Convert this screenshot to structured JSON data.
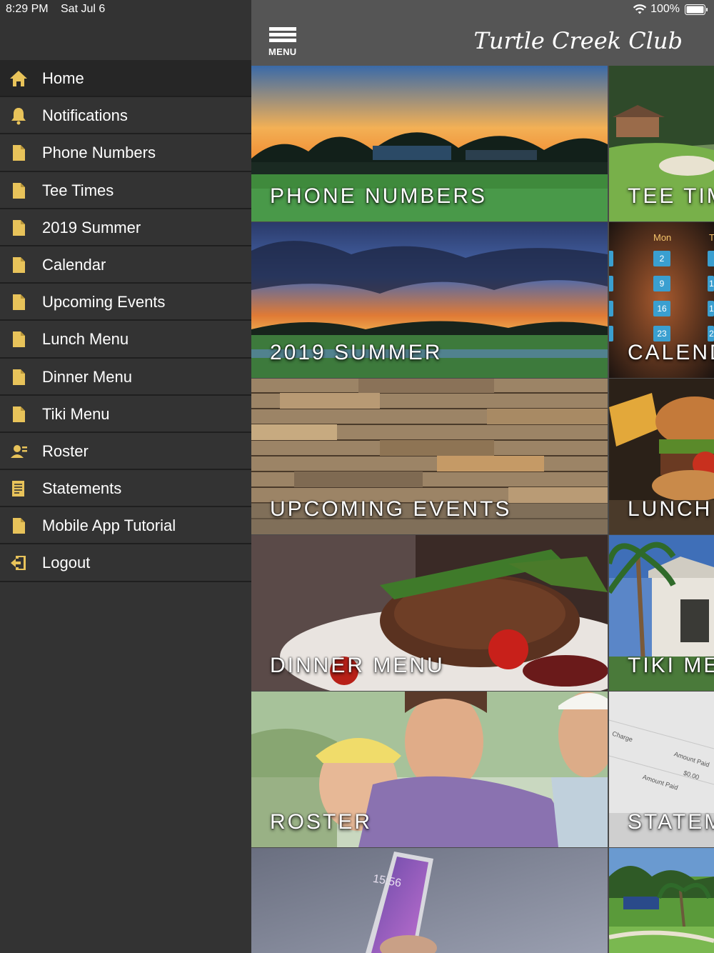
{
  "status_bar": {
    "time": "8:29 PM",
    "date": "Sat Jul 6",
    "battery": "100%"
  },
  "header": {
    "menu_label": "MENU",
    "logo_text": "Turtle Creek Club"
  },
  "colors": {
    "accent": "#e8c35a",
    "sidebar_bg": "#333333",
    "divider": "#1f1f1f",
    "topbar_bg": "#555555"
  },
  "sidebar": {
    "items": [
      {
        "label": "Home",
        "icon": "home-icon",
        "active": true
      },
      {
        "label": "Notifications",
        "icon": "bell-icon"
      },
      {
        "label": "Phone Numbers",
        "icon": "document-icon"
      },
      {
        "label": "Tee Times",
        "icon": "document-icon"
      },
      {
        "label": "2019 Summer",
        "icon": "document-icon"
      },
      {
        "label": "Calendar",
        "icon": "document-icon"
      },
      {
        "label": "Upcoming Events",
        "icon": "document-icon"
      },
      {
        "label": "Lunch Menu",
        "icon": "document-icon"
      },
      {
        "label": "Dinner Menu",
        "icon": "document-icon"
      },
      {
        "label": "Tiki Menu",
        "icon": "document-icon"
      },
      {
        "label": "Roster",
        "icon": "roster-icon"
      },
      {
        "label": "Statements",
        "icon": "statement-icon"
      },
      {
        "label": "Mobile App Tutorial",
        "icon": "document-icon"
      },
      {
        "label": "Logout",
        "icon": "logout-icon"
      }
    ]
  },
  "tiles": [
    {
      "label": "PHONE NUMBERS",
      "image": "golf-clubhouse-sunset"
    },
    {
      "label": "TEE TIM",
      "image": "golf-course-clubhouse"
    },
    {
      "label": "2019 SUMMER",
      "image": "golf-course-sunset-clouds"
    },
    {
      "label": "CALEND",
      "image": "calendar-on-wood",
      "calendar": {
        "days": [
          "Mon",
          "Tu"
        ],
        "dates": [
          "2",
          "9",
          "16",
          "23"
        ],
        "partial": [
          "1",
          "1",
          "2"
        ]
      }
    },
    {
      "label": "UPCOMING EVENTS",
      "image": "wood-planks"
    },
    {
      "label": "LUNCH",
      "image": "burger-lunch"
    },
    {
      "label": "DINNER MENU",
      "image": "steak-dinner"
    },
    {
      "label": "TIKI ME",
      "image": "tiki-bar-palms"
    },
    {
      "label": "ROSTER",
      "image": "golfers-smiling"
    },
    {
      "label": "STATEM",
      "image": "statement-paper",
      "paper_text": [
        "Charge",
        "Amount Paid",
        "$0.00",
        "Amount Paid"
      ]
    },
    {
      "label": "",
      "image": "phone-in-hand",
      "phone_time": "15:56"
    },
    {
      "label": "",
      "image": "golf-course-aerial"
    }
  ]
}
